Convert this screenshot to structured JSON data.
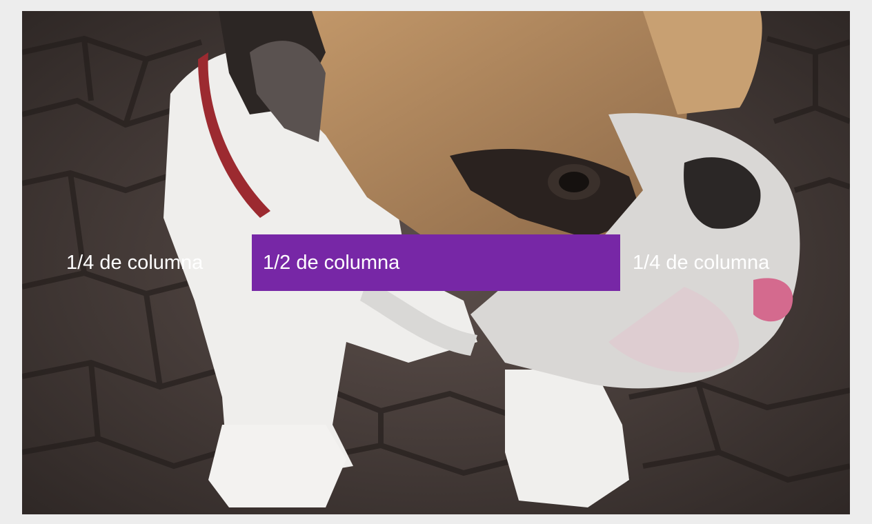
{
  "columns": [
    {
      "label": "1/4 de columna"
    },
    {
      "label": "1/2 de columna",
      "background": "#7727a6"
    },
    {
      "label": "1/4 de columna"
    }
  ],
  "cover": {
    "icon": "bulldog-photo",
    "colors": {
      "ground": "#4a3f3c",
      "fur_white": "#f2f1ef",
      "fur_tan": "#b58b5e",
      "collar": "#9c2a30"
    }
  }
}
